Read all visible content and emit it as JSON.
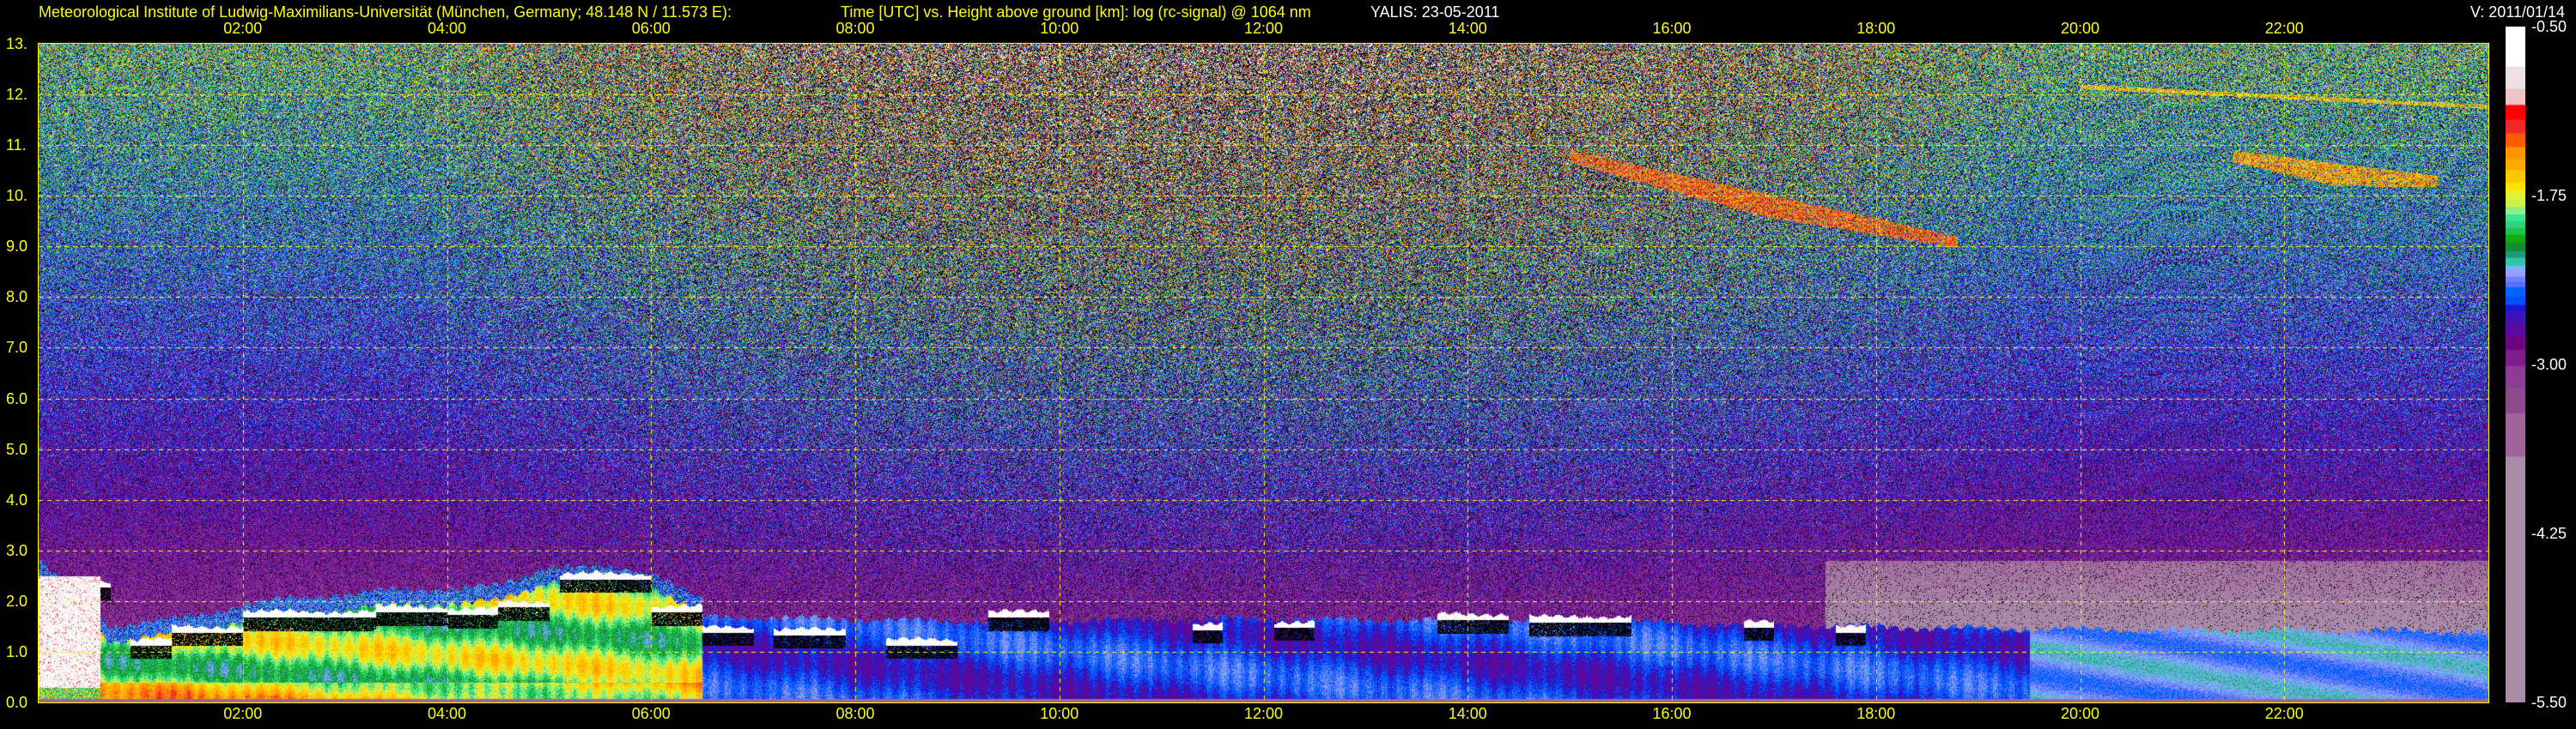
{
  "header": {
    "institute": "Meteorological Institute of Ludwig-Maximilians-Universität (München, Germany; 48.148 N / 11.573 E):",
    "plot_title": "Time [UTC] vs. Height above ground [km]: log (rc-signal) @ 1064 nm",
    "station": "YALIS: 23-05-2011",
    "version": "V: 2011/01/14"
  },
  "chart_data": {
    "type": "heatmap",
    "title": "Time [UTC] vs. Height above ground [km]: log (rc-signal) @ 1064 nm",
    "xlabel": "Time [UTC]",
    "ylabel": "Height above ground [km]",
    "xlim": [
      0,
      24
    ],
    "ylim": [
      0,
      13
    ],
    "grid": true,
    "x_ticks": [
      {
        "value": 2,
        "label": "02:00"
      },
      {
        "value": 4,
        "label": "04:00"
      },
      {
        "value": 6,
        "label": "06:00"
      },
      {
        "value": 8,
        "label": "08:00"
      },
      {
        "value": 10,
        "label": "10:00"
      },
      {
        "value": 12,
        "label": "12:00"
      },
      {
        "value": 14,
        "label": "14:00"
      },
      {
        "value": 16,
        "label": "16:00"
      },
      {
        "value": 18,
        "label": "18:00"
      },
      {
        "value": 20,
        "label": "20:00"
      },
      {
        "value": 22,
        "label": "22:00"
      }
    ],
    "y_ticks": [
      {
        "value": 0,
        "label": "0.0"
      },
      {
        "value": 1,
        "label": "1.0"
      },
      {
        "value": 2,
        "label": "2.0"
      },
      {
        "value": 3,
        "label": "3.0"
      },
      {
        "value": 4,
        "label": "4.0"
      },
      {
        "value": 5,
        "label": "5.0"
      },
      {
        "value": 6,
        "label": "6.0"
      },
      {
        "value": 7,
        "label": "7.0"
      },
      {
        "value": 8,
        "label": "8.0"
      },
      {
        "value": 9,
        "label": "9.0"
      },
      {
        "value": 10,
        "label": "10."
      },
      {
        "value": 11,
        "label": "11."
      },
      {
        "value": 12,
        "label": "12."
      },
      {
        "value": 13,
        "label": "13."
      }
    ],
    "colorbar": {
      "range": [
        -5.5,
        -0.5
      ],
      "ticks": [
        {
          "value": -0.5,
          "label": "-0.50"
        },
        {
          "value": -1.75,
          "label": "-1.75"
        },
        {
          "value": -3.0,
          "label": "-3.00"
        },
        {
          "value": -4.25,
          "label": "-4.25"
        },
        {
          "value": -5.5,
          "label": "-5.50"
        }
      ],
      "bands": [
        {
          "min": -0.8,
          "color": "#ffffff"
        },
        {
          "min": -0.965,
          "color": "#ece0e2"
        },
        {
          "min": -1.08,
          "color": "#f0c4c4"
        },
        {
          "min": -1.19,
          "color": "#ff0000"
        },
        {
          "min": -1.29,
          "color": "#f02828"
        },
        {
          "min": -1.39,
          "color": "#ff5a00"
        },
        {
          "min": -1.48,
          "color": "#ff9600"
        },
        {
          "min": -1.56,
          "color": "#ffaa00"
        },
        {
          "min": -1.65,
          "color": "#ffc800"
        },
        {
          "min": -1.71,
          "color": "#ffe100"
        },
        {
          "min": -1.78,
          "color": "#e6f032"
        },
        {
          "min": -1.84,
          "color": "#c8f050"
        },
        {
          "min": -1.89,
          "color": "#8cf08c"
        },
        {
          "min": -1.94,
          "color": "#3ce696"
        },
        {
          "min": -1.99,
          "color": "#32d278"
        },
        {
          "min": -2.04,
          "color": "#1ec350"
        },
        {
          "min": -2.1,
          "color": "#14aa14"
        },
        {
          "min": -2.16,
          "color": "#148c32"
        },
        {
          "min": -2.21,
          "color": "#1e9678"
        },
        {
          "min": -2.27,
          "color": "#32c3aa"
        },
        {
          "min": -2.3,
          "color": "#78b4ff"
        },
        {
          "min": -2.35,
          "color": "#96a0ff"
        },
        {
          "min": -2.39,
          "color": "#6e82ff"
        },
        {
          "min": -2.43,
          "color": "#5a6eff"
        },
        {
          "min": -2.5,
          "color": "#0064ff"
        },
        {
          "min": -2.56,
          "color": "#0050ff"
        },
        {
          "min": -2.61,
          "color": "#1e14d2"
        },
        {
          "min": -2.69,
          "color": "#3c14b4"
        },
        {
          "min": -2.79,
          "color": "#5a0aa0"
        },
        {
          "min": -2.89,
          "color": "#6e0082"
        },
        {
          "min": -3.01,
          "color": "#7d1e8c"
        },
        {
          "min": -3.17,
          "color": "#8c3c96"
        },
        {
          "min": -3.36,
          "color": "#8c4a8c"
        },
        {
          "min": -3.68,
          "color": "#a0649b"
        },
        {
          "min": -5.5,
          "color": "#a88ca8"
        }
      ]
    },
    "boundary_layer_top_km": [
      [
        0,
        2.5
      ],
      [
        0.7,
        1.2
      ],
      [
        1.5,
        1.4
      ],
      [
        2.2,
        1.7
      ],
      [
        3.3,
        1.9
      ],
      [
        4.5,
        2.0
      ],
      [
        5.0,
        2.4
      ],
      [
        6.0,
        2.3
      ],
      [
        6.5,
        1.7
      ],
      [
        9,
        1.6
      ],
      [
        12,
        1.65
      ],
      [
        15,
        1.6
      ],
      [
        18,
        1.5
      ],
      [
        19.5,
        1.45
      ],
      [
        24,
        1.4
      ]
    ],
    "clouds": [
      {
        "start": 0.3,
        "end": 0.7,
        "base_km": 2.4
      },
      {
        "start": 0.9,
        "end": 1.3,
        "base_km": 1.25
      },
      {
        "start": 1.3,
        "end": 2.0,
        "base_km": 1.5
      },
      {
        "start": 2.0,
        "end": 3.3,
        "base_km": 1.8
      },
      {
        "start": 3.3,
        "end": 4.0,
        "base_km": 1.9
      },
      {
        "start": 4.0,
        "end": 4.5,
        "base_km": 1.85
      },
      {
        "start": 4.5,
        "end": 5.0,
        "base_km": 2.0
      },
      {
        "start": 5.1,
        "end": 6.0,
        "base_km": 2.55
      },
      {
        "start": 5.9,
        "end": 6.5,
        "base_km": 1.9
      },
      {
        "start": 6.5,
        "end": 7.0,
        "base_km": 1.5
      },
      {
        "start": 7.2,
        "end": 7.9,
        "base_km": 1.45
      },
      {
        "start": 8.3,
        "end": 9.0,
        "base_km": 1.25
      },
      {
        "start": 9.3,
        "end": 9.9,
        "base_km": 1.8
      },
      {
        "start": 11.3,
        "end": 11.6,
        "base_km": 1.55
      },
      {
        "start": 12.1,
        "end": 12.5,
        "base_km": 1.6
      },
      {
        "start": 13.7,
        "end": 14.4,
        "base_km": 1.75
      },
      {
        "start": 14.6,
        "end": 15.6,
        "base_km": 1.7
      },
      {
        "start": 16.7,
        "end": 17.0,
        "base_km": 1.6
      },
      {
        "start": 17.6,
        "end": 17.9,
        "base_km": 1.5
      }
    ],
    "cirrus": [
      {
        "start": 15.0,
        "end": 18.8,
        "top_km_start": 10.9,
        "top_km_end": 9.2,
        "value": -1.35
      },
      {
        "start": 21.5,
        "end": 23.5,
        "top_km_start": 10.9,
        "top_km_end": 10.4,
        "value": -1.5
      },
      {
        "start": 20.0,
        "end": 24.0,
        "top_km_start": 12.2,
        "top_km_end": 11.8,
        "value": -1.6
      }
    ]
  }
}
